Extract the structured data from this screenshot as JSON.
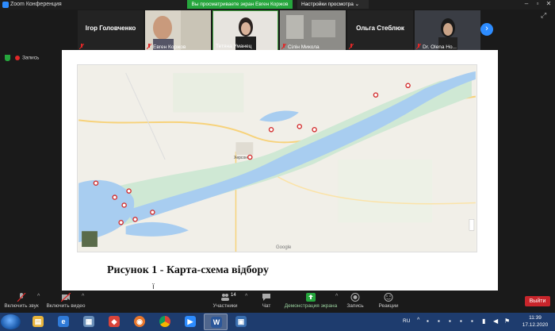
{
  "window": {
    "title": "Zoom Конференция",
    "share_banner": "Вы просматриваете экран Евген Коржов",
    "view_options": "Настройки просмотра"
  },
  "participants": [
    {
      "name": "Ігор Головченко",
      "kind": "name-only",
      "muted": true
    },
    {
      "name": "Евген Коржов",
      "kind": "video",
      "muted": true
    },
    {
      "name": "Тетяна Уманец",
      "kind": "video",
      "muted": false
    },
    {
      "name": "Сілін Микола",
      "kind": "video",
      "muted": true
    },
    {
      "name": "Ольга Стеблюк",
      "kind": "name-only",
      "muted": true
    },
    {
      "name": "Dr. Olena Ho...",
      "kind": "video",
      "muted": true
    }
  ],
  "recording": {
    "label": "Запись"
  },
  "document": {
    "caption": "Рисунок 1 - Карта-схема відбору",
    "caption_fragment": "ї",
    "map": {
      "labels": [
        "Херсон",
        "Google"
      ],
      "sample_points": 13
    }
  },
  "toolbar": {
    "audio": "Включить звук",
    "video": "Включить видео",
    "participants": "Участники",
    "participants_count": "14",
    "chat": "Чат",
    "share": "Демонстрация экрана",
    "record": "Запись",
    "reactions": "Реакции",
    "end": "Выйти"
  },
  "taskbar": {
    "lang": "RU",
    "time": "11:39",
    "date": "17.12.2020"
  },
  "colors": {
    "accent": "#2d8cff",
    "share_green": "#26a63d",
    "end_red": "#c8252b",
    "river": "#a8cdf0"
  }
}
